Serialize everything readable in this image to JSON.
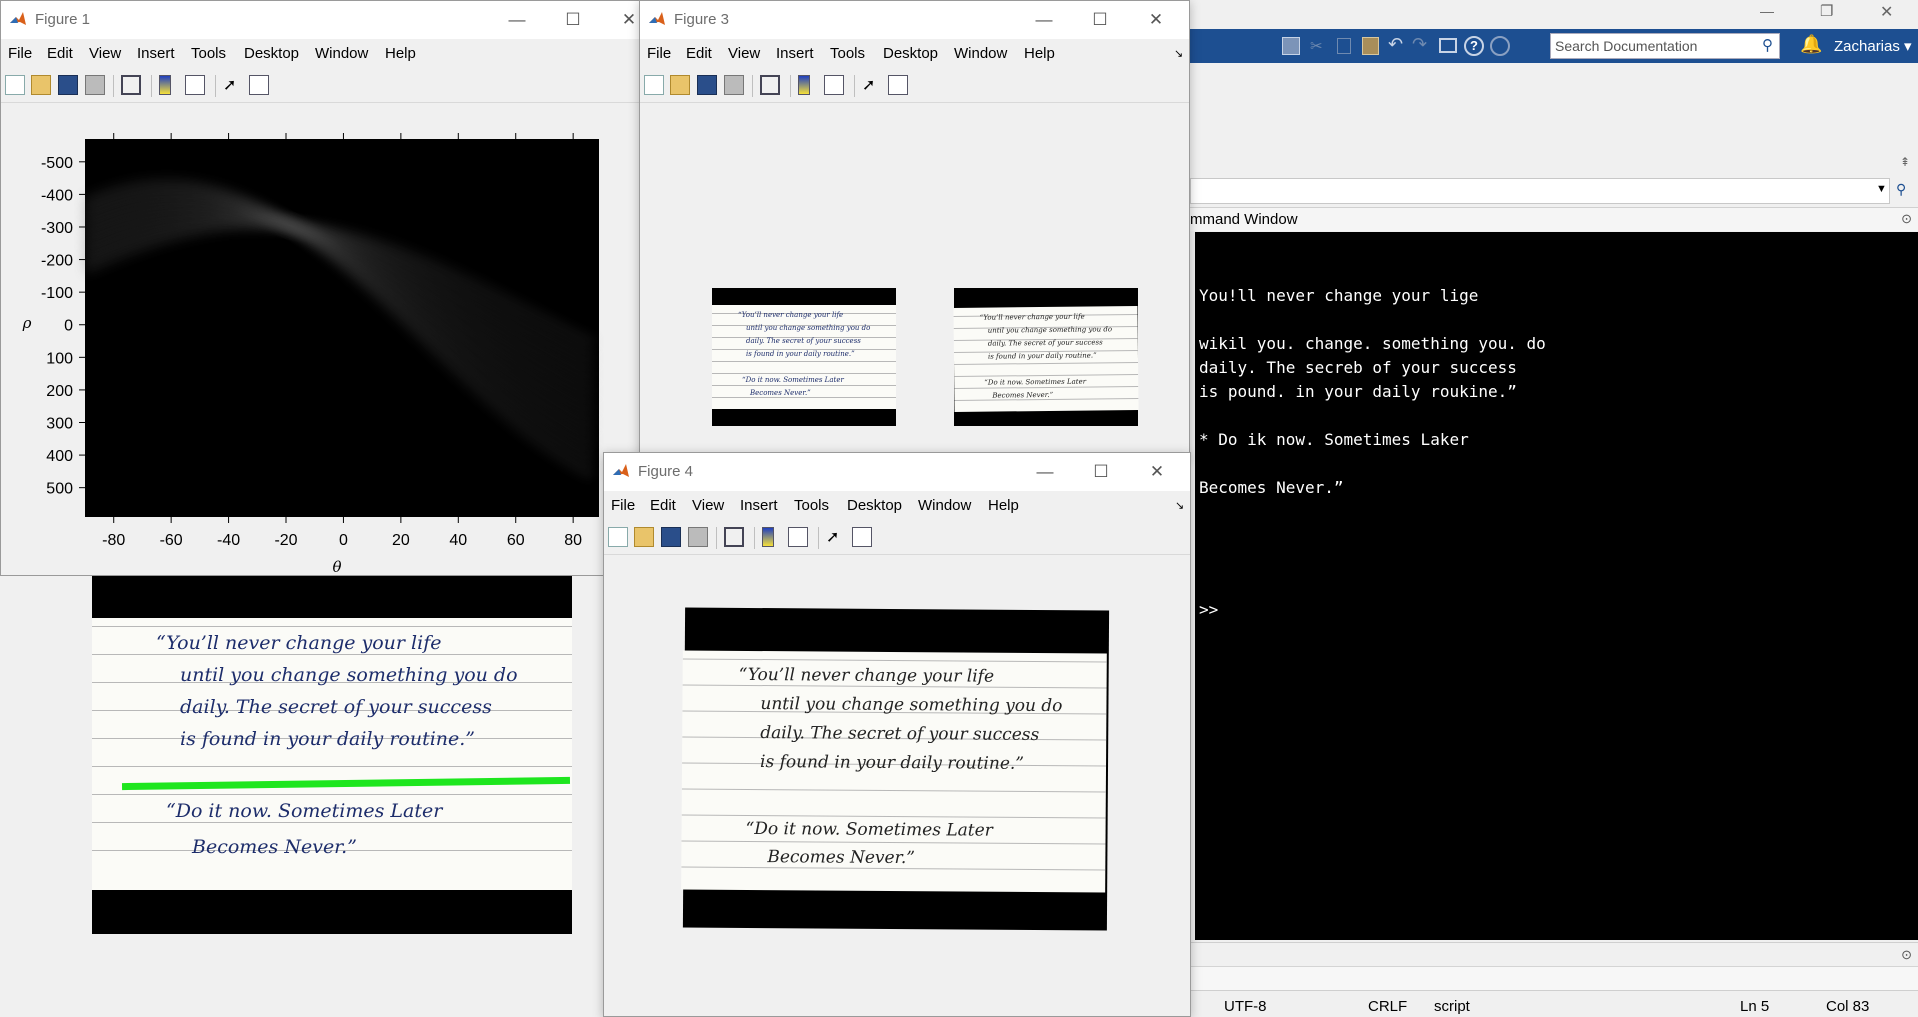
{
  "colors": {
    "matlab_blue": "#1d4f91",
    "cmd_bg": "#000000",
    "hough_line": "#1ee61e"
  },
  "matlab": {
    "window_controls": {
      "minimize": "—",
      "restore": "❐",
      "close": "✕"
    },
    "search": {
      "placeholder": "Search Documentation"
    },
    "user": "Zacharias",
    "panel_title": "Command Window",
    "panel_title_visible": "mmand Window",
    "command_output": [
      "You!ll never change your lige",
      "",
      "wikil you. change. something you. do",
      "daily. The secreb of your success",
      "is pound. in your daily roukine.”",
      "",
      "* Do ik now. Sometimes Laker",
      "",
      "Becomes Never.”"
    ],
    "prompt": ">>",
    "status": {
      "encoding": "UTF-8",
      "eol": "CRLF",
      "type": "script",
      "line": "Ln  5",
      "col": "Col  83"
    }
  },
  "menu": [
    "File",
    "Edit",
    "View",
    "Insert",
    "Tools",
    "Desktop",
    "Window",
    "Help"
  ],
  "figures": {
    "fig1": {
      "title": "Figure 1"
    },
    "fig3": {
      "title": "Figure 3"
    },
    "fig4": {
      "title": "Figure 4"
    }
  },
  "note_text": {
    "lines": [
      "“You’ll never change your life",
      "until you change something you do",
      "daily. The secret of your success",
      "is found in your daily routine.”",
      "“Do it now. Sometimes Later",
      "Becomes Never.”"
    ]
  },
  "chart_data": {
    "type": "heatmap",
    "title": "",
    "xlabel": "θ",
    "ylabel": "ρ",
    "x_ticks": [
      -80,
      -60,
      -40,
      -20,
      0,
      20,
      40,
      60,
      80
    ],
    "y_ticks": [
      -500,
      -400,
      -300,
      -200,
      -100,
      0,
      100,
      200,
      300,
      400,
      500
    ],
    "xlim": [
      -90,
      89
    ],
    "ylim": [
      -570,
      590
    ],
    "colormap": "gray"
  }
}
